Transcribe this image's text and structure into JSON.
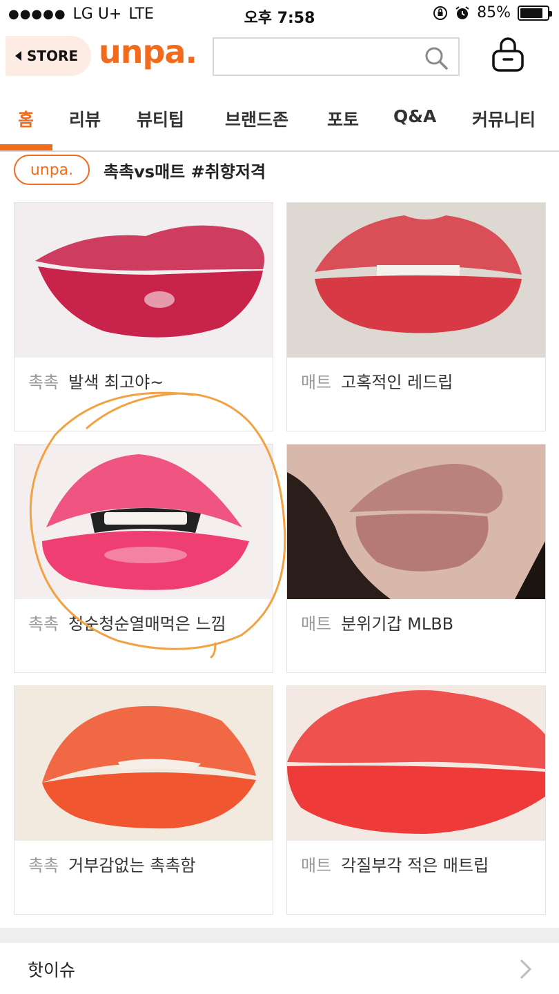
{
  "status_bar": {
    "signal": "●●●●●",
    "carrier": "LG U+",
    "network": "LTE",
    "time": "오후 7:58",
    "battery_percent": "85%",
    "battery_level": 0.85
  },
  "header": {
    "store_label": "STORE",
    "logo_text": "unpa.",
    "search_placeholder": "",
    "search_icon": "search-icon",
    "bag_icon": "shopping-bag-icon"
  },
  "tabs": [
    {
      "label": "홈",
      "active": true
    },
    {
      "label": "리뷰"
    },
    {
      "label": "뷰티팁"
    },
    {
      "label": "브랜드존"
    },
    {
      "label": "포토"
    },
    {
      "label": "Q&A"
    },
    {
      "label": "커뮤니티"
    }
  ],
  "section": {
    "brand_tag": "unpa.",
    "title": "촉촉vs매트 #취향저격"
  },
  "cards": [
    {
      "tag": "촉촉",
      "text": "발색 최고야~",
      "lip_color": "#c8234a",
      "bg": "#f2eef0"
    },
    {
      "tag": "매트",
      "text": "고혹적인 레드립",
      "lip_color": "#d83a45",
      "bg": "#ddd8d2"
    },
    {
      "tag": "촉촉",
      "text": "청순청순열매먹은 느낌",
      "lip_color": "#ef3f72",
      "bg": "#f4efee"
    },
    {
      "tag": "매트",
      "text": "분위기갑 MLBB",
      "lip_color": "#b57a76",
      "bg": "#d7b8aa"
    },
    {
      "tag": "촉촉",
      "text": "거부감없는 촉촉함",
      "lip_color": "#f0562f",
      "bg": "#f3eadf"
    },
    {
      "tag": "매트",
      "text": "각질부각 적은 매트립",
      "lip_color": "#ee3b3a",
      "bg": "#f4e9e2"
    }
  ],
  "hot_issue": {
    "label": "핫이슈"
  },
  "colors": {
    "accent": "#f26a1b",
    "annotation": "#f2a243"
  }
}
